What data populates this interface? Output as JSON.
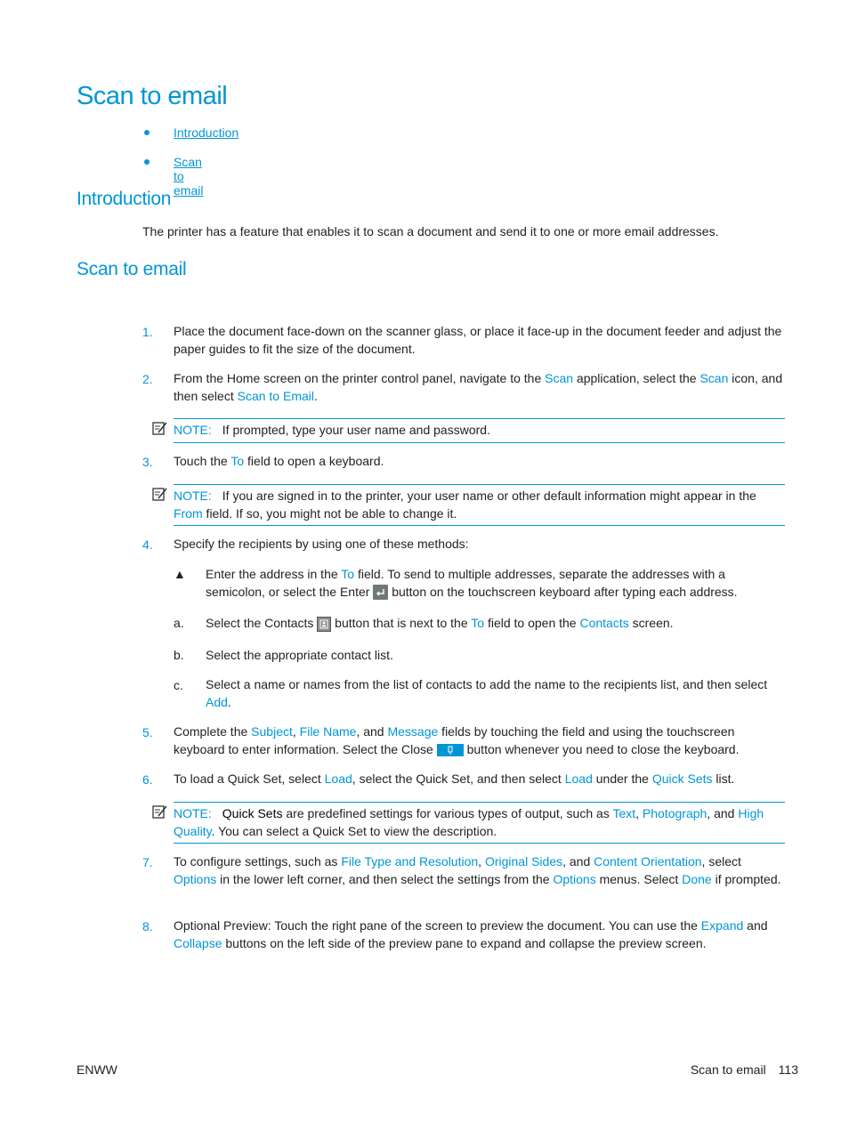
{
  "page": {
    "title": "Scan to email",
    "toc": [
      {
        "label": "Introduction"
      },
      {
        "label": "Scan to email"
      }
    ],
    "intro": {
      "heading": "Introduction",
      "text": "The printer has a feature that enables it to scan a document and send it to one or more email addresses."
    },
    "scan": {
      "heading": "Scan to email",
      "steps": [
        {
          "num": "1.",
          "parts": [
            "Place the document face-down on the scanner glass, or place it face-up in the document feeder and adjust the paper guides to fit the size of the document."
          ]
        },
        {
          "num": "2.",
          "t1": "From the Home screen on the printer control panel, navigate to the ",
          "l1": "Scan",
          "t2": " application, select the ",
          "l2": "Scan",
          "t3": " icon, and then select ",
          "l3": "Scan to Email",
          "t4": "."
        },
        {
          "num": "3.",
          "t1": "Touch the ",
          "l1": "To",
          "t2": " field to open a keyboard."
        },
        {
          "num": "4.",
          "t1": "Specify the recipients by using one of these methods:"
        },
        {
          "num": "5.",
          "t1": "Complete the ",
          "l1": "Subject",
          "t2": ", ",
          "l2": "File Name",
          "t3": ", and ",
          "l3": "Message",
          "t4": " fields by touching the field and using the touchscreen keyboard to enter information. Select the Close ",
          "t5": " button whenever you need to close the keyboard."
        },
        {
          "num": "6.",
          "t1": "To load a Quick Set, select ",
          "l1": "Load",
          "t2": ", select the Quick Set, and then select ",
          "l2": "Load",
          "t3": " under the ",
          "l3": "Quick Sets",
          "t4": " list."
        },
        {
          "num": "7.",
          "t1": "To configure settings, such as ",
          "l1": "File Type and Resolution",
          "t2": ", ",
          "l2": "Original Sides",
          "t3": ", and ",
          "l3": "Content Orientation",
          "t4": ", select ",
          "l4": "Options",
          "t5": " in the lower left corner, and then select the settings from the ",
          "l5": "Options",
          "t6": " menus. Select ",
          "l6": "Done",
          "t7": " if prompted."
        },
        {
          "num": "8.",
          "t1": "Optional Preview: Touch the right pane of the screen to preview the document. You can use the ",
          "l1": "Expand",
          "t2": " and ",
          "l2": "Collapse",
          "t3": " buttons on the left side of the preview pane to expand and collapse the preview screen."
        }
      ],
      "notes": [
        {
          "label": "NOTE:",
          "t1": "If prompted, type your user name and password."
        },
        {
          "label": "NOTE:",
          "t1": "If you are signed in to the printer, your user name or other default information might appear in the ",
          "l1": "From",
          "t2": " field. If so, you might not be able to change it."
        },
        {
          "label": "NOTE:",
          "b1": "Quick Sets",
          "t1": " are predefined settings for various types of output, such as ",
          "l1": "Text",
          "t2": ", ",
          "l2": "Photograph",
          "t3": ", and ",
          "l3": "High Quality",
          "t4": ". You can select a Quick Set to view the description."
        }
      ],
      "substeps": [
        {
          "marker": "▲",
          "t1": "Enter the address in the ",
          "l1": "To",
          "t2": " field. To send to multiple addresses, separate the addresses with a semicolon, or select the Enter ",
          "t3": " button on the touchscreen keyboard after typing each address."
        },
        {
          "marker": "a.",
          "t1": "Select the Contacts ",
          "t2": " button that is next to the ",
          "l1": "To",
          "t3": " field to open the ",
          "l2": "Contacts",
          "t4": " screen."
        },
        {
          "marker": "b.",
          "t1": "Select the appropriate contact list."
        },
        {
          "marker": "c.",
          "t1": "Select a name or names from the list of contacts to add the name to the recipients list, and then select ",
          "l1": "Add",
          "t2": "."
        }
      ]
    },
    "footer": {
      "left": "ENWW",
      "section": "Scan to email",
      "page_number": "113"
    }
  }
}
